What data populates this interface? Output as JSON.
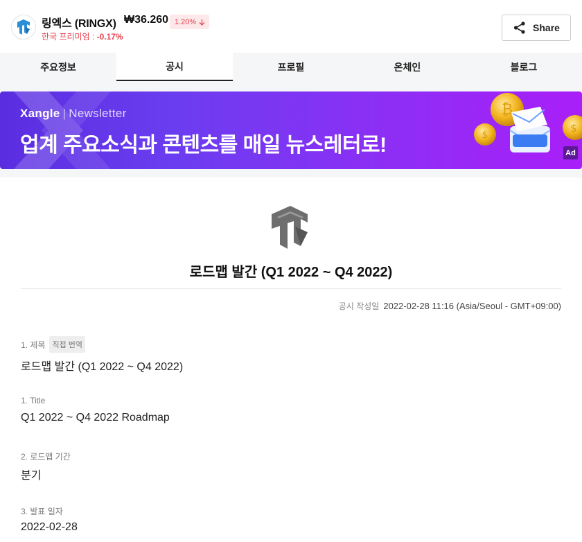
{
  "header": {
    "coin_name": "링엑스 (RINGX)",
    "price": "₩36.260",
    "change": "1.20%",
    "premium_label": "한국 프리미엄 : ",
    "premium_value": "-0.17%",
    "share_label": "Share"
  },
  "tabs": [
    "주요정보",
    "공시",
    "프로필",
    "온체인",
    "블로그"
  ],
  "active_tab": "공시",
  "banner": {
    "brand": "Xangle",
    "separator": "|",
    "sub": "Newsletter",
    "title": "업계 주요소식과 콘텐츠를 매일 뉴스레터로!",
    "ad_label": "Ad"
  },
  "disclosure": {
    "title": "로드맵 발간 (Q1 2022 ~ Q4 2022)",
    "date_label": "공시 작성일",
    "date_value": "2022-02-28 11:16 (Asia/Seoul - GMT+09:00)",
    "fields": [
      {
        "label": "1. 제목",
        "translate": "직접 번역",
        "value": "로드맵 발간 (Q1 2022 ~ Q4 2022)"
      },
      {
        "label": "1. Title",
        "value": "Q1 2022 ~ Q4 2022 Roadmap"
      },
      {
        "label": "2. 로드맵 기간",
        "value": "분기"
      },
      {
        "label": "3. 발표 일자",
        "value": "2022-02-28"
      }
    ]
  },
  "colors": {
    "negative": "#e5434f",
    "banner_start": "#5a2ee0",
    "banner_end": "#a91ff8"
  }
}
